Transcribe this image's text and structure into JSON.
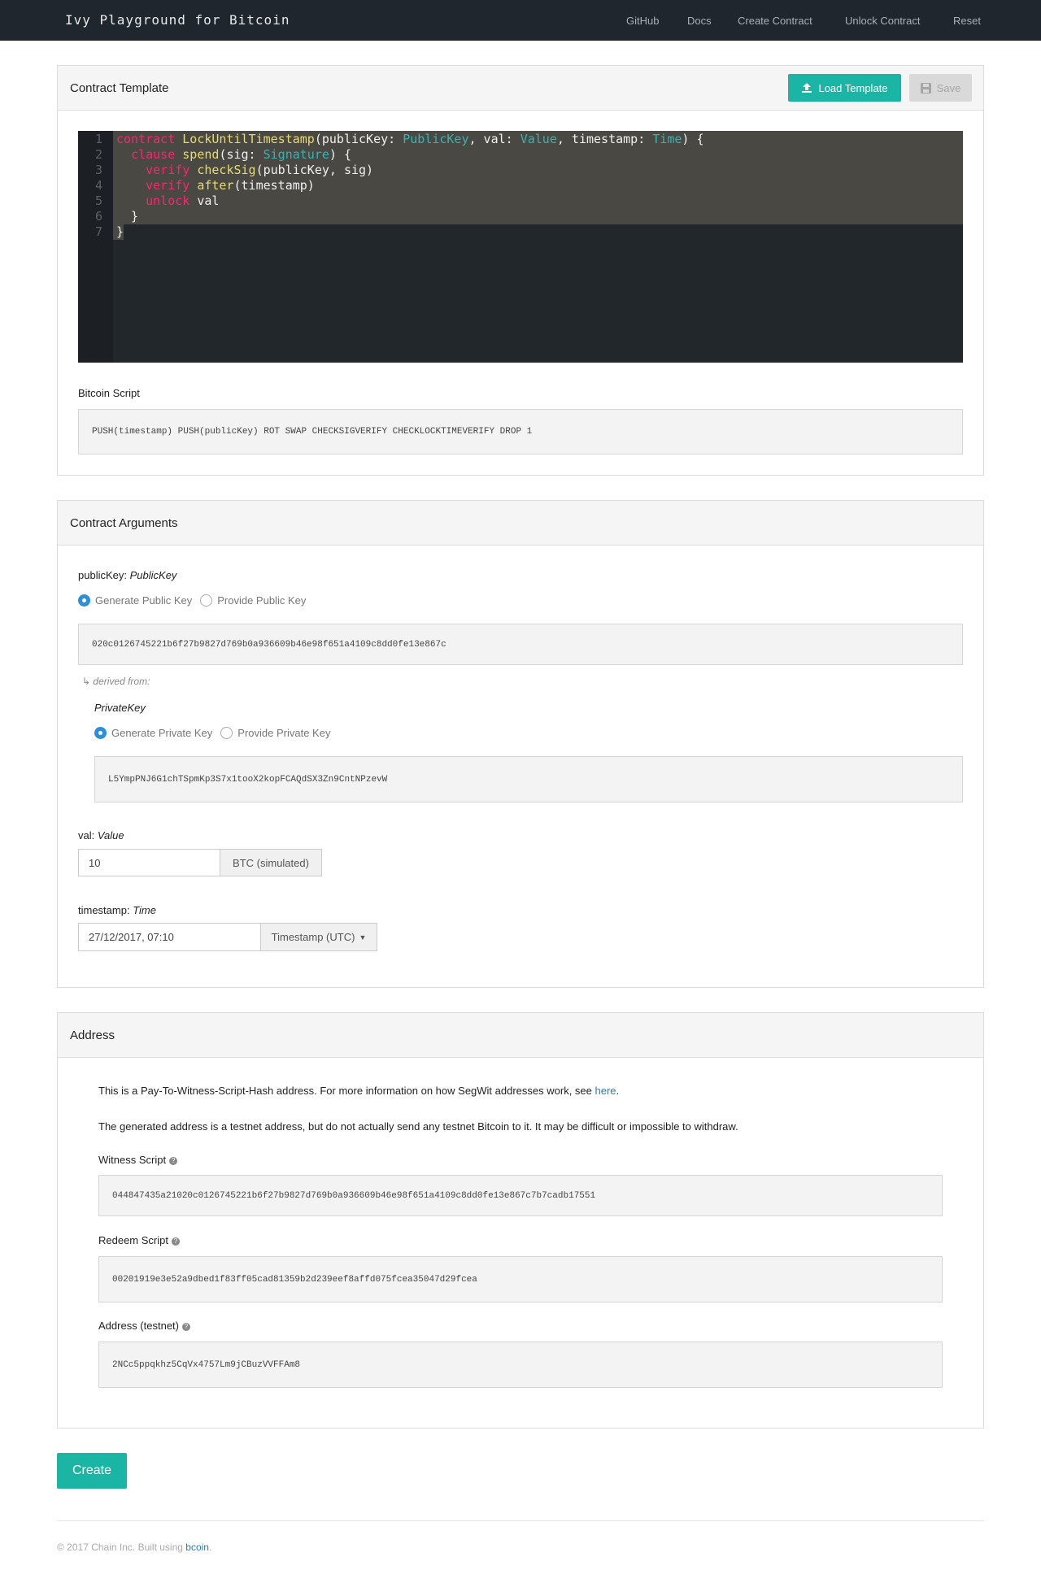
{
  "nav": {
    "brand": "Ivy Playground for Bitcoin",
    "links": [
      "GitHub",
      "Docs",
      "Create Contract",
      "Unlock Contract",
      "Reset"
    ]
  },
  "template_panel": {
    "title": "Contract Template",
    "load_label": "Load Template",
    "save_label": "Save",
    "code_lines": [
      {
        "n": "1",
        "segments": [
          [
            "kw",
            "contract"
          ],
          [
            "txt",
            " "
          ],
          [
            "fn",
            "LockUntilTimestamp"
          ],
          [
            "txt",
            "(publicKey: "
          ],
          [
            "ty",
            "PublicKey"
          ],
          [
            "txt",
            ", val: "
          ],
          [
            "ty",
            "Value"
          ],
          [
            "txt",
            ", timestamp: "
          ],
          [
            "ty",
            "Time"
          ],
          [
            "txt",
            ") {"
          ]
        ]
      },
      {
        "n": "2",
        "segments": [
          [
            "txt",
            "  "
          ],
          [
            "kw",
            "clause"
          ],
          [
            "txt",
            " "
          ],
          [
            "fn",
            "spend"
          ],
          [
            "txt",
            "(sig: "
          ],
          [
            "ty",
            "Signature"
          ],
          [
            "txt",
            ") {"
          ]
        ]
      },
      {
        "n": "3",
        "segments": [
          [
            "txt",
            "    "
          ],
          [
            "kw",
            "verify"
          ],
          [
            "txt",
            " "
          ],
          [
            "fn",
            "checkSig"
          ],
          [
            "txt",
            "(publicKey, sig)"
          ]
        ]
      },
      {
        "n": "4",
        "segments": [
          [
            "txt",
            "    "
          ],
          [
            "kw",
            "verify"
          ],
          [
            "txt",
            " "
          ],
          [
            "fn",
            "after"
          ],
          [
            "txt",
            "(timestamp)"
          ]
        ]
      },
      {
        "n": "5",
        "segments": [
          [
            "txt",
            "    "
          ],
          [
            "kw",
            "unlock"
          ],
          [
            "txt",
            " val"
          ]
        ]
      },
      {
        "n": "6",
        "segments": [
          [
            "txt",
            "  }"
          ]
        ]
      },
      {
        "n": "7",
        "segments": [
          [
            "txt",
            "}"
          ]
        ]
      }
    ],
    "script_label": "Bitcoin Script",
    "script_value": "PUSH(timestamp) PUSH(publicKey) ROT SWAP CHECKSIGVERIFY CHECKLOCKTIMEVERIFY DROP 1"
  },
  "arguments_panel": {
    "title": "Contract Arguments",
    "pubkey_name": "publicKey:",
    "pubkey_type": "PublicKey",
    "pubkey_opt_generate": "Generate Public Key",
    "pubkey_opt_provide": "Provide Public Key",
    "pubkey_value": "020c0126745221b6f27b9827d769b0a936609b46e98f651a4109c8dd0fe13e867c",
    "derived_label": "derived from:",
    "privkey_type": "PrivateKey",
    "privkey_opt_generate": "Generate Private Key",
    "privkey_opt_provide": "Provide Private Key",
    "privkey_value": "L5YmpPNJ6G1chTSpmKp3S7x1tooX2kopFCAQdSX3Zn9CntNPzevW",
    "val_name": "val:",
    "val_type": "Value",
    "val_value": "10",
    "val_addon": "BTC (simulated)",
    "ts_name": "timestamp:",
    "ts_type": "Time",
    "ts_value": "27/12/2017, 07:10",
    "ts_addon": "Timestamp (UTC)"
  },
  "address_panel": {
    "title": "Address",
    "para1_text": "This is a Pay-To-Witness-Script-Hash address. For more information on how SegWit addresses work, see ",
    "para1_link": "here",
    "para1_end": ".",
    "para2": "The generated address is a testnet address, but do not actually send any testnet Bitcoin to it. It may be difficult or impossible to withdraw.",
    "witness_label": "Witness Script",
    "witness_value": "044847435a21020c0126745221b6f27b9827d769b0a936609b46e98f651a4109c8dd0fe13e867c7b7cadb17551",
    "redeem_label": "Redeem Script",
    "redeem_value": "00201919e3e52a9dbed1f83ff05cad81359b2d239eef8affd075fcea35047d29fcea",
    "address_label": "Address (testnet)",
    "address_value": "2NCc5ppqkhz5CqVx4757Lm9jCBuzVVFFAm8"
  },
  "create_label": "Create",
  "footer": {
    "text": "© 2017 Chain Inc. Built using ",
    "link": "bcoin",
    "end": "."
  },
  "colors": {
    "navbar": "#1f262d",
    "accent": "#1ab5a4",
    "link": "#2a7ab0",
    "radio_selected": "#2d8fd8"
  }
}
